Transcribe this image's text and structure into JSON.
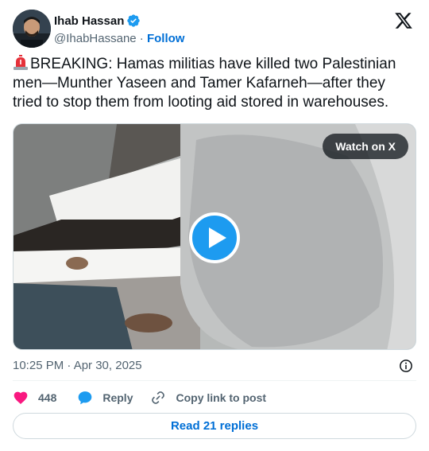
{
  "author": {
    "display_name": "Ihab Hassan",
    "handle": "@IhabHassane",
    "separator": " · ",
    "follow_label": "Follow",
    "verified_icon": "verified-badge-icon"
  },
  "tweet": {
    "text": "BREAKING: Hamas militias have killed two Palestinian men—Munther Yaseen and Tamer Kafarneh—after they tried to stop them from looting aid stored in warehouses.",
    "leading_emoji": "rotating-light-icon"
  },
  "media": {
    "watch_label": "Watch on X",
    "play_icon": "play-icon"
  },
  "meta": {
    "timestamp": "10:25 PM · Apr 30, 2025"
  },
  "actions": {
    "like_count": "448",
    "reply_label": "Reply",
    "copy_label": "Copy link to post"
  },
  "footer": {
    "read_replies_label": "Read 21 replies"
  },
  "colors": {
    "accent": "#1d9bf0",
    "link": "#006fd6",
    "like": "#f91880",
    "muted": "#536471"
  }
}
